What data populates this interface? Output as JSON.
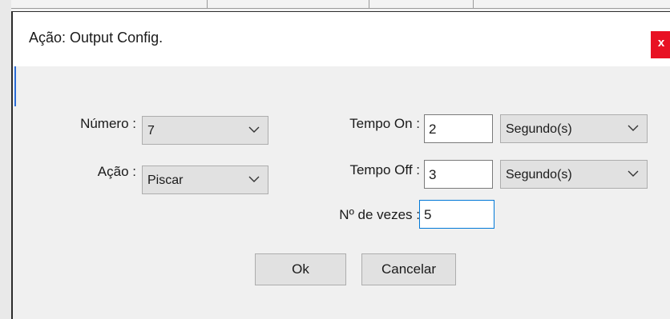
{
  "dialog": {
    "title": "Ação: Output Config.",
    "close_glyph": "x"
  },
  "form": {
    "numero": {
      "label": "Número :",
      "value": "7"
    },
    "acao": {
      "label": "Ação :",
      "value": "Piscar"
    },
    "tempo_on": {
      "label": "Tempo On :",
      "value": "2",
      "unit": "Segundo(s)"
    },
    "tempo_off": {
      "label": "Tempo Off :",
      "value": "3",
      "unit": "Segundo(s)"
    },
    "vezes": {
      "label": "Nº de vezes :",
      "value": "5"
    }
  },
  "buttons": {
    "ok": "Ok",
    "cancel": "Cancelar"
  },
  "icons": {
    "dropdown": "chevron-down-icon",
    "close": "close-icon"
  },
  "colors": {
    "close_red": "#e81123",
    "focus_blue": "#0078d7"
  }
}
